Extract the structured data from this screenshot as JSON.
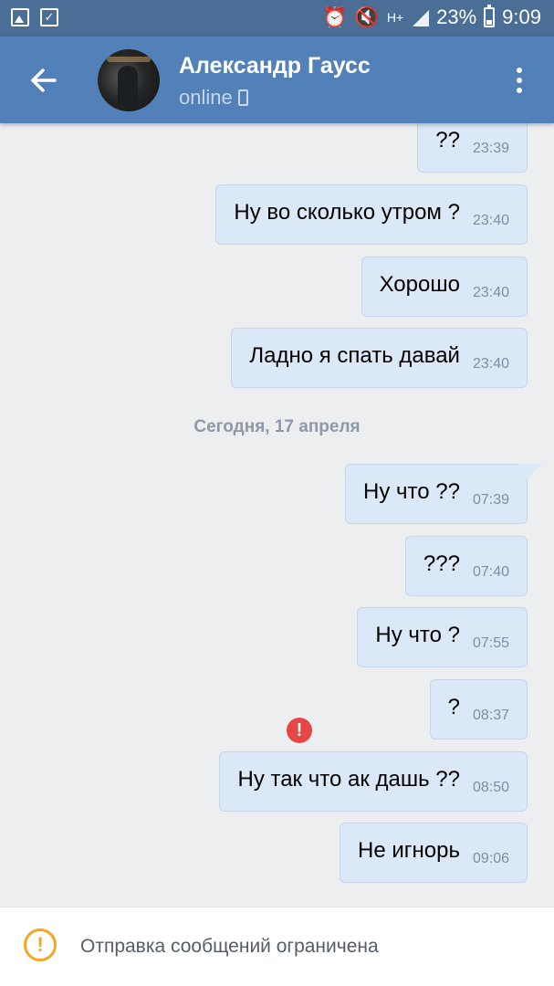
{
  "status_bar": {
    "left_icons": [
      "gallery-icon",
      "checklist-icon"
    ],
    "network": "H+",
    "battery": "23%",
    "time": "9:09"
  },
  "header": {
    "name": "Александр Гаусс",
    "presence": "online"
  },
  "messages": [
    {
      "text": "??",
      "time": "23:39"
    },
    {
      "text": "Ну во сколько утром ?",
      "time": "23:40"
    },
    {
      "text": "Хорошо",
      "time": "23:40"
    },
    {
      "text": "Ладно я спать давай",
      "time": "23:40"
    },
    {
      "text": "Ну что ??",
      "time": "07:39"
    },
    {
      "text": "???",
      "time": "07:40"
    },
    {
      "text": "Ну что ?",
      "time": "07:55"
    },
    {
      "text": "?",
      "time": "08:37"
    },
    {
      "text": "Ну так что ак дашь ??",
      "time": "08:50"
    },
    {
      "text": "Не игнорь",
      "time": "09:06"
    }
  ],
  "date_separator": "Сегодня, 17 апреля",
  "bottom_bar": {
    "notice": "Отправка сообщений ограничена"
  },
  "colors": {
    "header": "#5181b8",
    "status_bar": "#4a6e95",
    "bubble": "#dbe8f7",
    "background": "#edeef0",
    "error": "#e64646",
    "warning": "#f5a623"
  }
}
